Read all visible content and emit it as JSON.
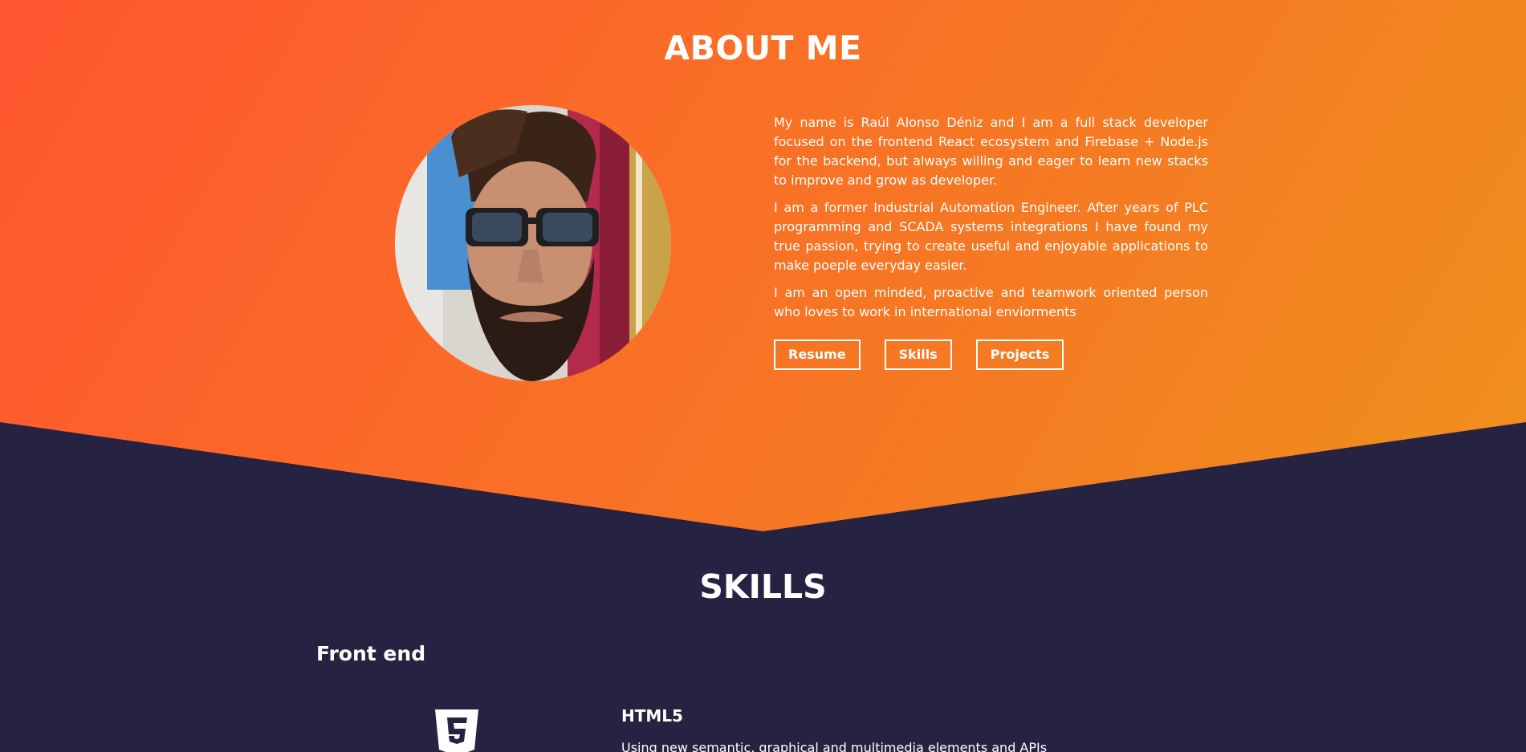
{
  "colors": {
    "gradient_start": "#ff5530",
    "gradient_end": "#ef911c",
    "dark_background": "#262241",
    "text": "#ffffff"
  },
  "about": {
    "title": "ABOUT ME",
    "paragraphs": [
      "My name is Raúl Alonso Déniz and I am a full stack developer focused on the frontend React ecosystem and Firebase + Node.js for the backend, but always willing and eager to learn new stacks to improve and grow as developer.",
      "I am a former Industrial Automation Engineer. After years of PLC programming and SCADA systems integrations I have found my true passion, trying to create useful and enjoyable applications to make poeple everyday easier.",
      "I am an open minded, proactive and teamwork oriented person who loves to work in international enviorments"
    ],
    "buttons": {
      "resume": "Resume",
      "skills": "Skills",
      "projects": "Projects"
    }
  },
  "skills": {
    "title": "SKILLS",
    "category": "Front end",
    "items": [
      {
        "icon": "html5-icon",
        "name": "HTML5",
        "description": "Using new semantic, graphical and multimedia elements and APIs"
      }
    ]
  }
}
